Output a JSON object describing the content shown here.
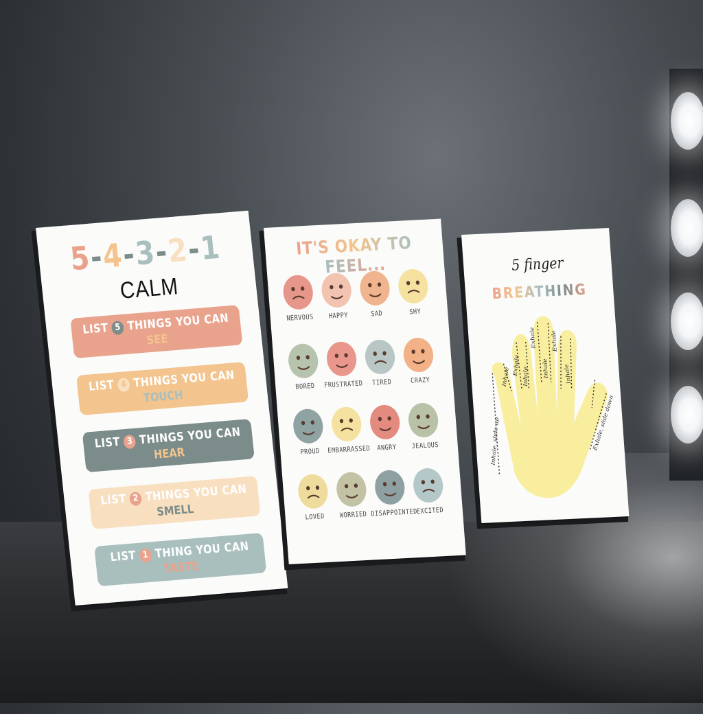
{
  "scene": {
    "colors": {
      "peach": "#e9a38c",
      "orange": "#f3c48d",
      "slate": "#7b8c8a",
      "cream": "#f8dfc0",
      "sage": "#a9bfbe",
      "yellow": "#f6eba2"
    }
  },
  "poster_calm": {
    "countdown": [
      "5",
      "-",
      "4",
      "-",
      "3",
      "-",
      "2",
      "-",
      "1"
    ],
    "title": "CALM",
    "items": [
      {
        "prefix": "LIST",
        "number": "5",
        "middle": "THINGS YOU CAN",
        "sense": "SEE",
        "bg": "#e9a38c",
        "num_bg": "#7b8c8a",
        "sense_color": "#f3c48d"
      },
      {
        "prefix": "LIST",
        "number": "4",
        "middle": "THINGS YOU CAN",
        "sense": "TOUCH",
        "bg": "#f3c48d",
        "num_bg": "#f8dfc0",
        "sense_color": "#a9bfbe"
      },
      {
        "prefix": "LIST",
        "number": "3",
        "middle": "THINGS YOU CAN",
        "sense": "HEAR",
        "bg": "#7b8c8a",
        "num_bg": "#e9a38c",
        "sense_color": "#f3c48d"
      },
      {
        "prefix": "LIST",
        "number": "2",
        "middle": "THINGS YOU CAN",
        "sense": "SMELL",
        "bg": "#f8dfc0",
        "num_bg": "#e9a38c",
        "sense_color": "#7b8c8a"
      },
      {
        "prefix": "LIST",
        "number": "1",
        "middle": "THING YOU CAN",
        "sense": "TASTE",
        "bg": "#a9bfbe",
        "num_bg": "#e9a38c",
        "sense_color": "#e9a38c"
      }
    ]
  },
  "poster_feel": {
    "title": "IT'S OKAY TO FEEL...",
    "emotions": [
      {
        "label": "NERVOUS",
        "face": "#e6968a"
      },
      {
        "label": "HAPPY",
        "face": "#f2c3b1"
      },
      {
        "label": "SAD",
        "face": "#f0b48e"
      },
      {
        "label": "SHY",
        "face": "#f6e2a0"
      },
      {
        "label": "BORED",
        "face": "#b7c4ad"
      },
      {
        "label": "FRUSTRATED",
        "face": "#e9978c"
      },
      {
        "label": "TIRED",
        "face": "#b8c6c6"
      },
      {
        "label": "CRAZY",
        "face": "#f2b186"
      },
      {
        "label": "PROUD",
        "face": "#8fa3a3"
      },
      {
        "label": "EMBARRASSED",
        "face": "#f6e2a0"
      },
      {
        "label": "ANGRY",
        "face": "#e48b80"
      },
      {
        "label": "JEALOUS",
        "face": "#b9c1a6"
      },
      {
        "label": "LOVED",
        "face": "#eedc9c"
      },
      {
        "label": "WORRIED",
        "face": "#c3c2a4"
      },
      {
        "label": "DISAPPOINTED",
        "face": "#8ea0a2"
      },
      {
        "label": "EXCITED",
        "face": "#b5c8c9"
      }
    ]
  },
  "poster_breathing": {
    "line1": "5 finger",
    "line2": "BREATHING",
    "hand_color": "#f8ee9e",
    "labels": {
      "inhale_up": "Inhale, slide up",
      "inhale": "Inhale",
      "exhale": "Exhale",
      "exhale_down": "Exhale, slide down"
    }
  }
}
